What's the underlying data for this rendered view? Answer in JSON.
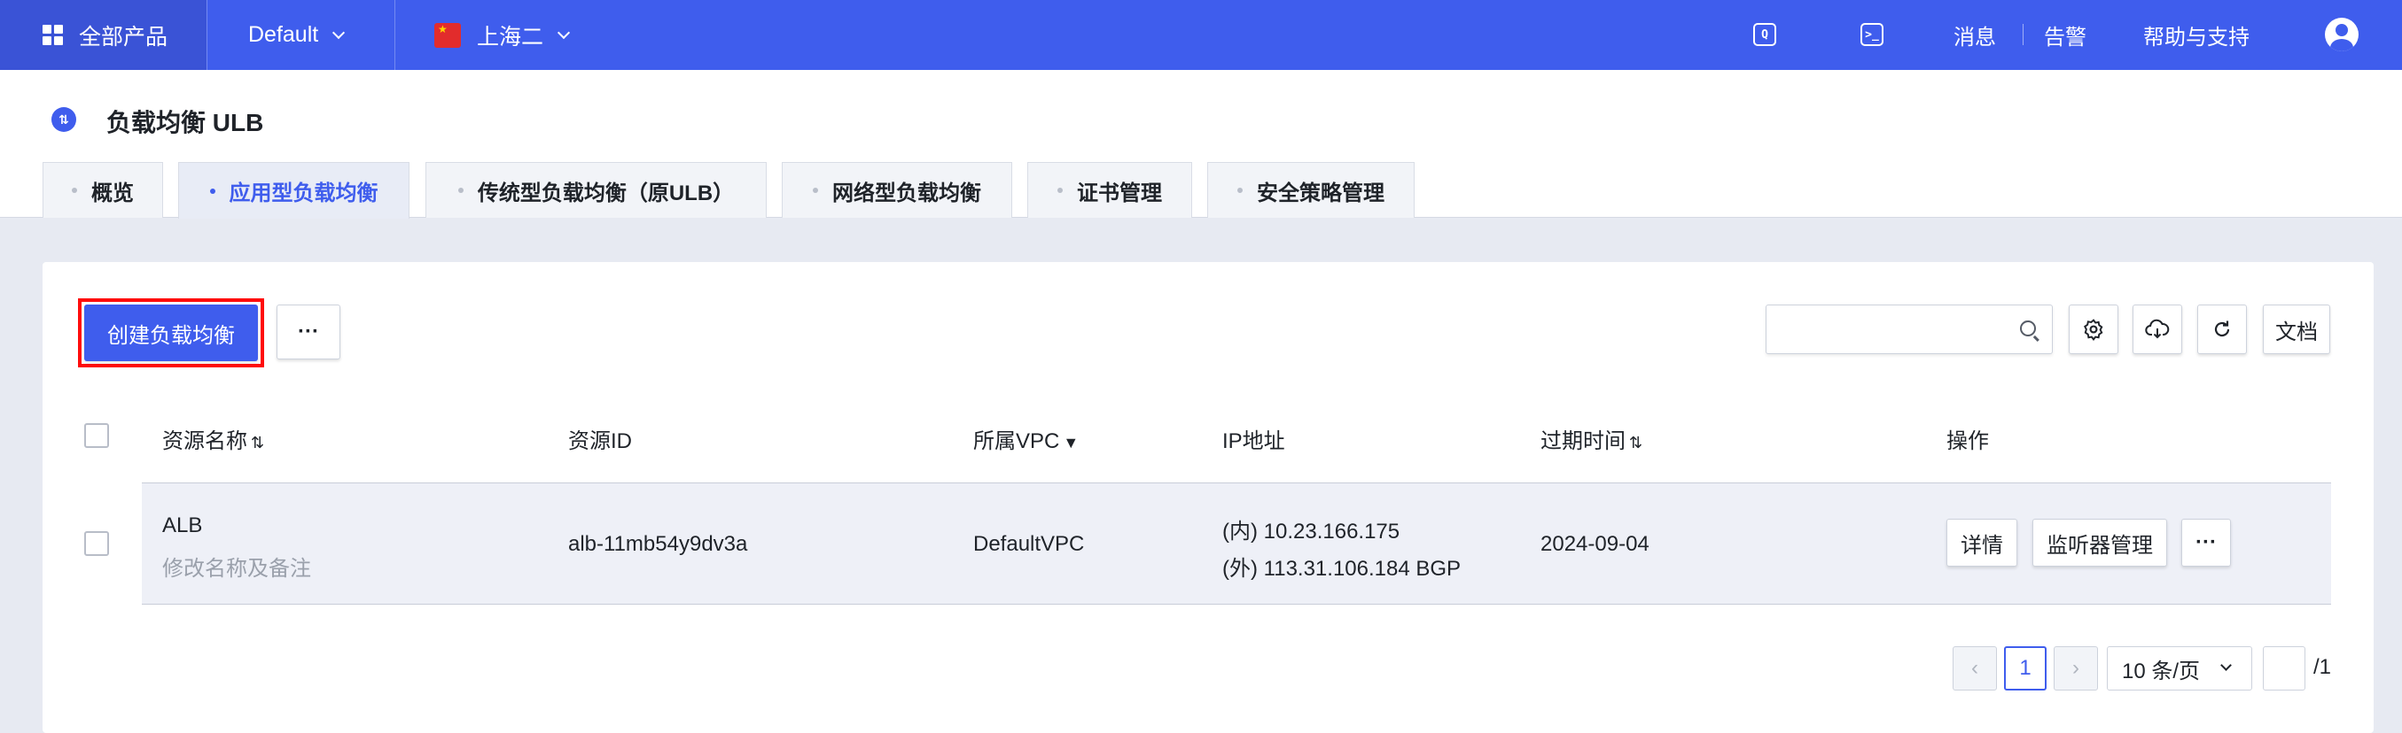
{
  "topbar": {
    "products_label": "全部产品",
    "project_label": "Default",
    "region_label": "上海二",
    "messages_label": "消息",
    "alerts_label": "告警",
    "help_label": "帮助与支持"
  },
  "page": {
    "title": "负载均衡 ULB",
    "tabs": [
      {
        "label": "概览",
        "active": false
      },
      {
        "label": "应用型负载均衡",
        "active": true
      },
      {
        "label": "传统型负载均衡（原ULB）",
        "active": false
      },
      {
        "label": "网络型负载均衡",
        "active": false
      },
      {
        "label": "证书管理",
        "active": false
      },
      {
        "label": "安全策略管理",
        "active": false
      }
    ]
  },
  "toolbar": {
    "create_label": "创建负载均衡",
    "more_label": "···",
    "search_placeholder": "",
    "docs_label": "文档"
  },
  "table": {
    "headers": {
      "name": "资源名称",
      "id": "资源ID",
      "vpc": "所属VPC",
      "ip": "IP地址",
      "expire": "过期时间",
      "actions": "操作"
    },
    "rows": [
      {
        "name": "ALB",
        "name_edit": "修改名称及备注",
        "id": "alb-11mb54y9dv3a",
        "vpc": "DefaultVPC",
        "ip_internal": "(内) 10.23.166.175",
        "ip_external": "(外) 113.31.106.184 BGP",
        "expire": "2024-09-04",
        "action_detail": "详情",
        "action_listener": "监听器管理",
        "action_more": "···"
      }
    ]
  },
  "pagination": {
    "prev": "‹",
    "current_page": "1",
    "next": "›",
    "page_size": "10 条/页",
    "total_pages": "/1"
  },
  "colors": {
    "brand": "#3f5ded",
    "highlight": "#ff0a0a"
  }
}
